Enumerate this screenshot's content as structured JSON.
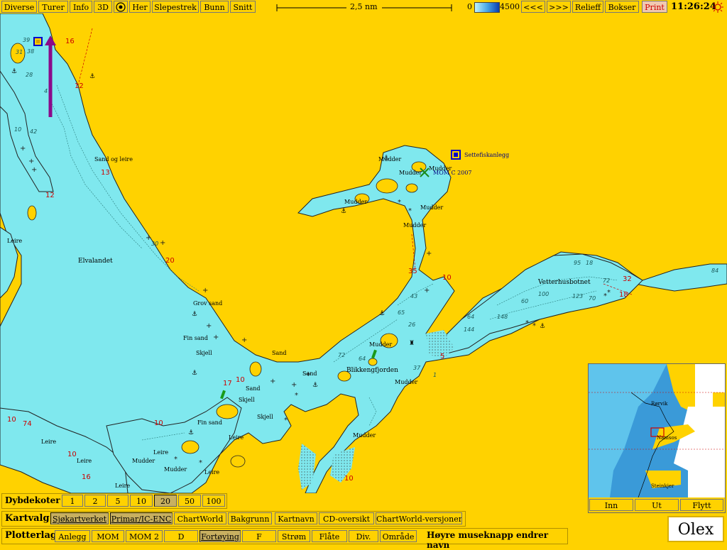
{
  "toolbar": {
    "diverse": "Diverse",
    "turer": "Turer",
    "info": "Info",
    "three_d": "3D",
    "her": "Her",
    "slepestrek": "Slepestrek",
    "bunn": "Bunn",
    "snitt": "Snitt",
    "scale_text": "2,5 nm",
    "depth_min": "0",
    "depth_max": "4500",
    "prev": "<<<",
    "next": ">>>",
    "relieff": "Relieff",
    "bokser": "Bokser",
    "print": "Print",
    "clock": "11:26:24"
  },
  "map": {
    "place_labels": [
      "Elvalandet",
      "Vetterhusbotnet",
      "Blikkengfjorden",
      "Settefiskanlegg",
      "MOM C 2007"
    ],
    "seabed_labels": [
      "Sand og leire",
      "Grov sand",
      "Fin sand",
      "Skjell",
      "Sand",
      "Sand",
      "Sand",
      "Fin sand",
      "Skjell",
      "Skjell",
      "Leire",
      "Leire",
      "Leire",
      "Leire",
      "Leire",
      "Leire",
      "Leire",
      "Mudder",
      "Mudder",
      "Mudder",
      "Mudder",
      "Mudder",
      "Mudder",
      "Mudder",
      "Mudder",
      "Mudder",
      "Mudder",
      "Mudder"
    ],
    "contour_labels": [
      "16",
      "12",
      "12",
      "13",
      "20",
      "10",
      "17",
      "10",
      "10",
      "35",
      "10",
      "5",
      "18",
      "32",
      "74",
      "10",
      "16",
      "10"
    ],
    "depth_labels": [
      "39",
      "31",
      "38",
      "28",
      "10",
      "42",
      "43",
      "65",
      "72",
      "64",
      "37",
      "26",
      "148",
      "144",
      "64",
      "95",
      "18",
      "72",
      "100",
      "123",
      "70",
      "60",
      "84",
      "30",
      "1",
      "4"
    ]
  },
  "inset": {
    "labels": [
      "Rørvik",
      "Namsos",
      "Steinkjer"
    ],
    "inn": "Inn",
    "ut": "Ut",
    "flytt": "Flytt"
  },
  "dybdekoter": {
    "label": "Dybdekoter",
    "values": [
      "1",
      "2",
      "5",
      "10",
      "20",
      "50",
      "100"
    ],
    "selected": "20"
  },
  "kartvalg": {
    "label": "Kartvalg",
    "items": [
      "Sjøkartverket",
      "Primar/IC-ENC",
      "ChartWorld",
      "Bakgrunn",
      "Kartnavn",
      "CD-oversikt",
      "ChartWorld-versjoner"
    ]
  },
  "plotterlag": {
    "label": "Plotterlag",
    "items": [
      "Anlegg",
      "MOM",
      "MOM 2",
      "D",
      "Fortøying",
      "F",
      "Strøm",
      "Flåte",
      "Div.",
      "Område"
    ],
    "hint": "Høyre museknapp endrer navn"
  },
  "brand": "Olex",
  "colors": {
    "land": "#FFD200",
    "water": "#7FE8EE",
    "deep_water": "#4FB8E0",
    "contour_red": "#cc0000",
    "route_purple": "#8a0a8a",
    "marker_blue": "#0000cc"
  }
}
